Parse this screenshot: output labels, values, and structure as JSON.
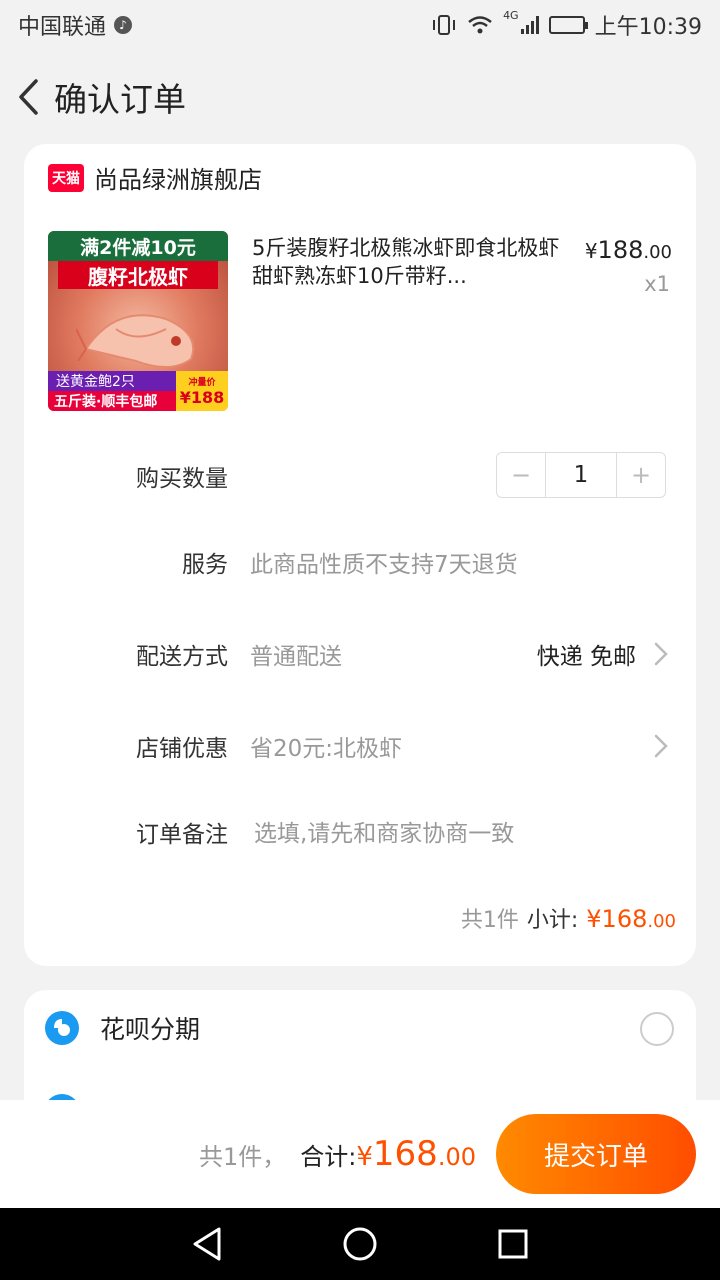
{
  "status_bar": {
    "carrier": "中国联通",
    "network": "4G",
    "time": "上午10:39"
  },
  "header": {
    "title": "确认订单"
  },
  "store": {
    "badge": "天猫",
    "name": "尚品绿洲旗舰店"
  },
  "product": {
    "image_promo_top": "满2件减10元",
    "image_promo_title": "腹籽北极虾",
    "image_gift": "送黄金鲍2只",
    "image_ship": "五斤装·顺丰包邮",
    "image_price_tag": "冲量价",
    "image_price": "¥188",
    "title": "5斤装腹籽北极熊冰虾即食北极虾甜虾熟冻虾10斤带籽...",
    "price_symbol": "¥",
    "price_int": "188",
    "price_cents": ".00",
    "quantity_label": "x1"
  },
  "form": {
    "quantity_label": "购买数量",
    "quantity_value": "1",
    "minus": "−",
    "plus": "+",
    "service_label": "服务",
    "service_value": "此商品性质不支持7天退货",
    "delivery_label": "配送方式",
    "delivery_value": "普通配送",
    "delivery_right": "快递 免邮",
    "discount_label": "店铺优惠",
    "discount_value": "省20元:北极虾",
    "remark_label": "订单备注",
    "remark_placeholder": "选填,请先和商家协商一致"
  },
  "subtotal": {
    "count": "共1件",
    "label": "小计:",
    "symbol": "¥",
    "int": "168",
    "cents": ".00"
  },
  "payment": {
    "huabei_label": "花呗分期"
  },
  "bottom": {
    "count": "共1件，",
    "total_label": "合计:",
    "symbol": "¥",
    "int": "168",
    "cents": ".00",
    "submit": "提交订单"
  },
  "colors": {
    "accent": "#ff5000",
    "tmall_red": "#ff0036"
  },
  "icons": [
    "back-arrow-icon",
    "chevron-right-icon",
    "huabei-icon",
    "radio-icon",
    "nav-back-icon",
    "nav-home-icon",
    "nav-recents-icon"
  ]
}
